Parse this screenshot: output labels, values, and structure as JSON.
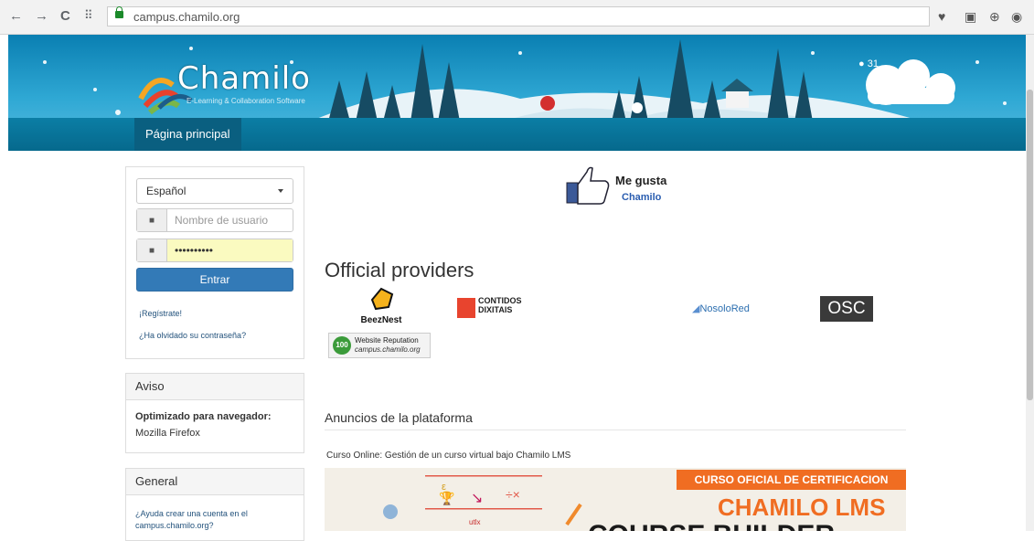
{
  "browser": {
    "url": "campus.chamilo.org",
    "back_icon": "←",
    "forward_icon": "→",
    "reload_icon": "C",
    "apps_icon": "⠿"
  },
  "header": {
    "logo_text": "Chamilo",
    "logo_tagline": "E-Learning & Collaboration Software",
    "online_users": "31",
    "nav_home": "Página principal"
  },
  "login": {
    "language": "Español",
    "username_placeholder": "Nombre de usuario",
    "password_value": "••••••••••",
    "submit_label": "Entrar",
    "register_link": "¡Regístrate!",
    "forgot_link": "¿Ha olvidado su contraseña?"
  },
  "notice": {
    "title": "Aviso",
    "heading": "Optimizado para navegador:",
    "browser": "Mozilla Firefox"
  },
  "general": {
    "title": "General",
    "help_link": "¿Ayuda crear una cuenta en el campus.chamilo.org?"
  },
  "facebook": {
    "like_label": "Me gusta",
    "brand": "Chamilo"
  },
  "providers": {
    "heading": "Official providers",
    "items": [
      "BeezNest",
      "CONTIDOS DIXITAIS",
      "NosoloRed",
      "OSC"
    ],
    "reputation_line1": "Website Reputation",
    "reputation_line2": "campus.chamilo.org",
    "reputation_score": "100"
  },
  "announcements": {
    "heading": "Anuncios de la plataforma",
    "item_title": "Curso Online: Gestión de un curso virtual bajo Chamilo LMS",
    "banner_badge": "CURSO OFICIAL DE CERTIFICACION",
    "banner_title": "CHAMILO LMS",
    "banner_title2": "COURSE BUILDER"
  },
  "colors": {
    "banner_blue": "#0a7fb2",
    "nav_blue": "#06698d",
    "primary_button": "#337ab7",
    "accent_orange": "#f06d22"
  }
}
